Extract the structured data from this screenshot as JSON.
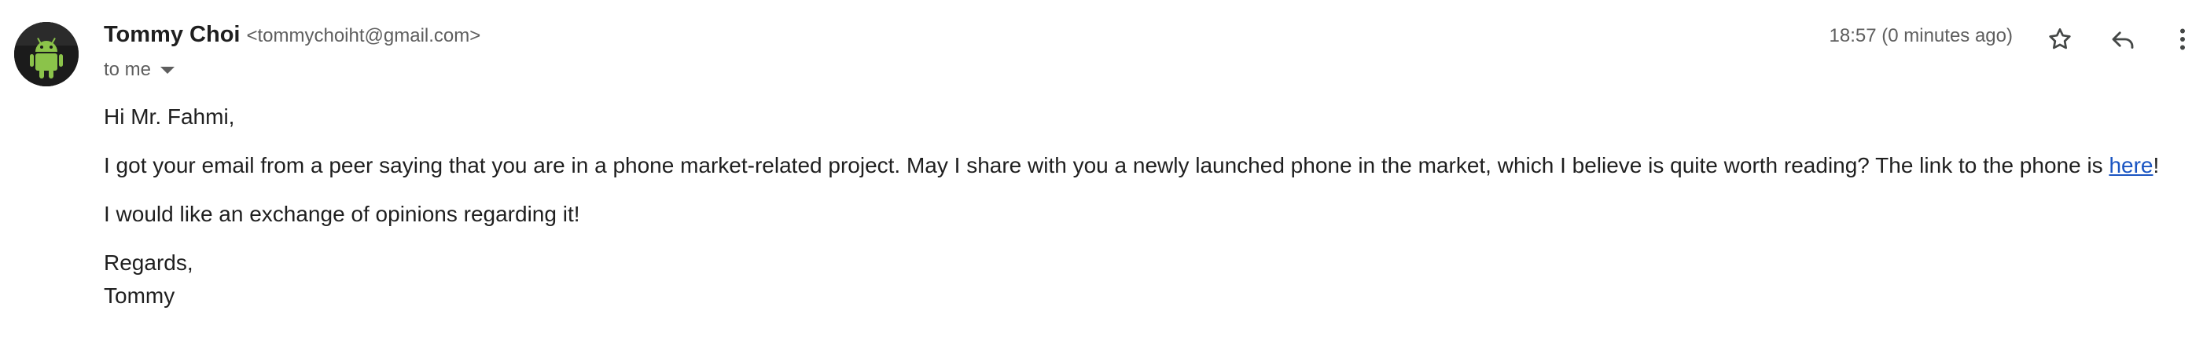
{
  "sender": {
    "name": "Tommy Choi",
    "email": "<tommychoiht@gmail.com>"
  },
  "recipient": {
    "to_label": "to me"
  },
  "meta": {
    "time": "18:57 (0 minutes ago)"
  },
  "icons": {
    "avatar": "android-robot-avatar",
    "star": "star-outline-icon",
    "reply": "reply-arrow-icon",
    "more": "vertical-ellipsis-icon",
    "caret": "chevron-down-icon"
  },
  "message": {
    "greeting": "Hi Mr. Fahmi,",
    "paragraph1_before_link": "I got your email from a peer saying that you are in a phone market-related project. May I share with you a newly launched phone in the market, which I believe is quite worth reading? The link to the phone is ",
    "link_text": "here",
    "paragraph1_after_link": "!",
    "paragraph2": "I would like an exchange of opinions regarding it!",
    "closing": "Regards,",
    "signature": "Tommy"
  },
  "colors": {
    "link": "#1a55c2",
    "muted_text": "#5e5e5e",
    "primary_text": "#1f1f1f"
  }
}
